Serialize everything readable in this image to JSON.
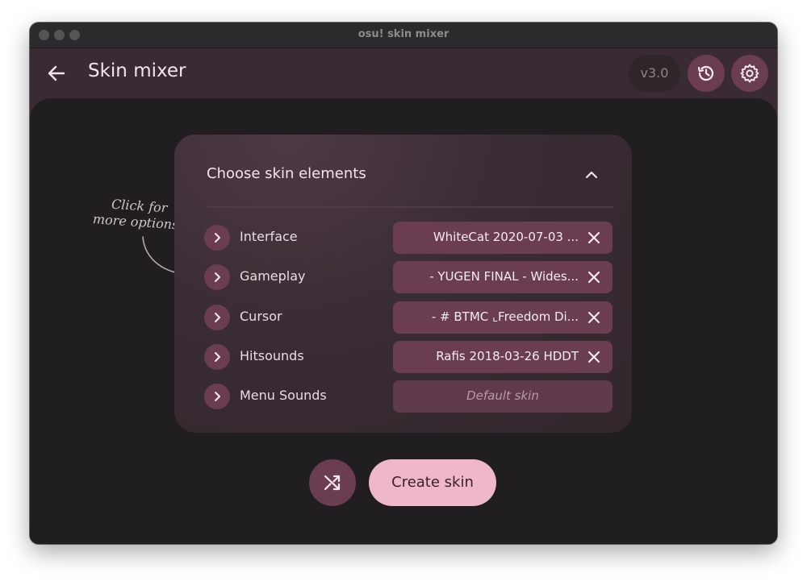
{
  "window": {
    "title": "osu! skin mixer"
  },
  "appbar": {
    "title": "Skin mixer",
    "version": "v3.0",
    "back_icon": "arrow-left-icon",
    "history_icon": "history-icon",
    "settings_icon": "gear-icon"
  },
  "card": {
    "title": "Choose skin elements",
    "collapse_icon": "chevron-up-icon",
    "rows": [
      {
        "label": "Interface",
        "value": "WhiteCat 2020-07-03 ...",
        "cleared": false
      },
      {
        "label": "Gameplay",
        "value": "- YUGEN FINAL - Wides...",
        "cleared": false
      },
      {
        "label": "Cursor",
        "value": "- # BTMC ⌞Freedom Di...",
        "cleared": false
      },
      {
        "label": "Hitsounds",
        "value": "Rafis 2018-03-26 HDDT",
        "cleared": false
      },
      {
        "label": "Menu Sounds",
        "placeholder": "Default skin",
        "cleared": true
      }
    ]
  },
  "hint": {
    "line1": "Click for",
    "line2": "more options!"
  },
  "actions": {
    "shuffle_icon": "shuffle-icon",
    "create_label": "Create skin"
  },
  "colors": {
    "accent": "#6a3d51",
    "primary_button": "#eeb8c9",
    "appbar": "#3a2a33",
    "background": "#201e21"
  }
}
